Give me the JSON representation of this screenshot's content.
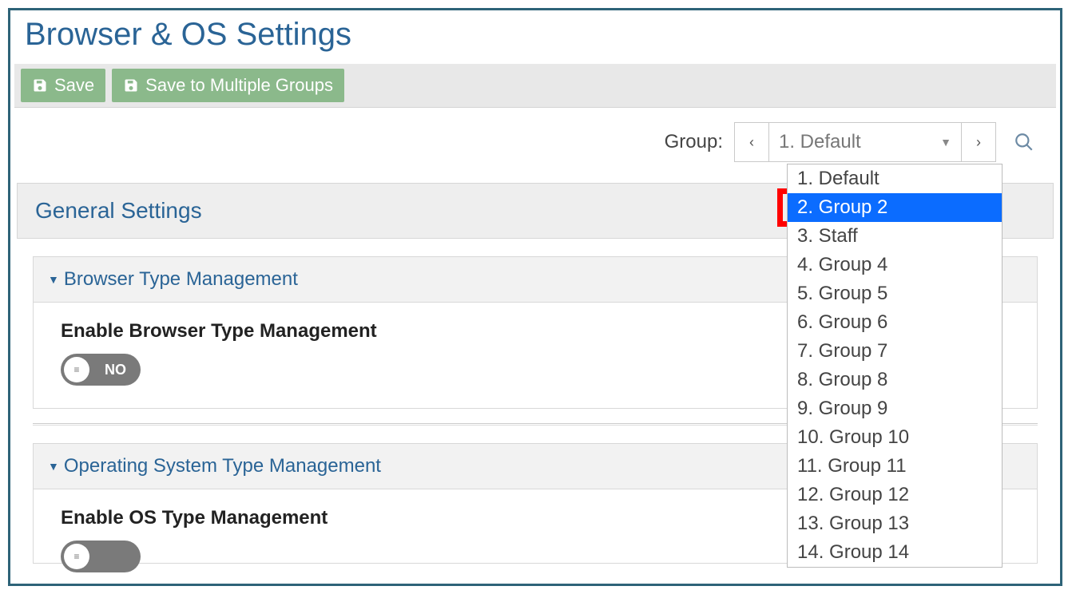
{
  "page": {
    "title": "Browser & OS Settings"
  },
  "toolbar": {
    "save_label": "Save",
    "save_multi_label": "Save to Multiple Groups"
  },
  "group_selector": {
    "label": "Group:",
    "selected": "1. Default",
    "options": [
      "1. Default",
      "2. Group 2",
      "3. Staff",
      "4. Group 4",
      "5. Group 5",
      "6. Group 6",
      "7. Group 7",
      "8. Group 8",
      "9. Group 9",
      "10. Group 10",
      "11. Group 11",
      "12. Group 12",
      "13. Group 13",
      "14. Group 14"
    ],
    "highlighted_index": 1
  },
  "sections": {
    "general": {
      "title": "General Settings"
    },
    "browser": {
      "title": "Browser Type Management",
      "setting_label": "Enable Browser Type Management",
      "toggle_value": "NO"
    },
    "os": {
      "title": "Operating System Type Management",
      "setting_label": "Enable OS Type Management"
    }
  }
}
